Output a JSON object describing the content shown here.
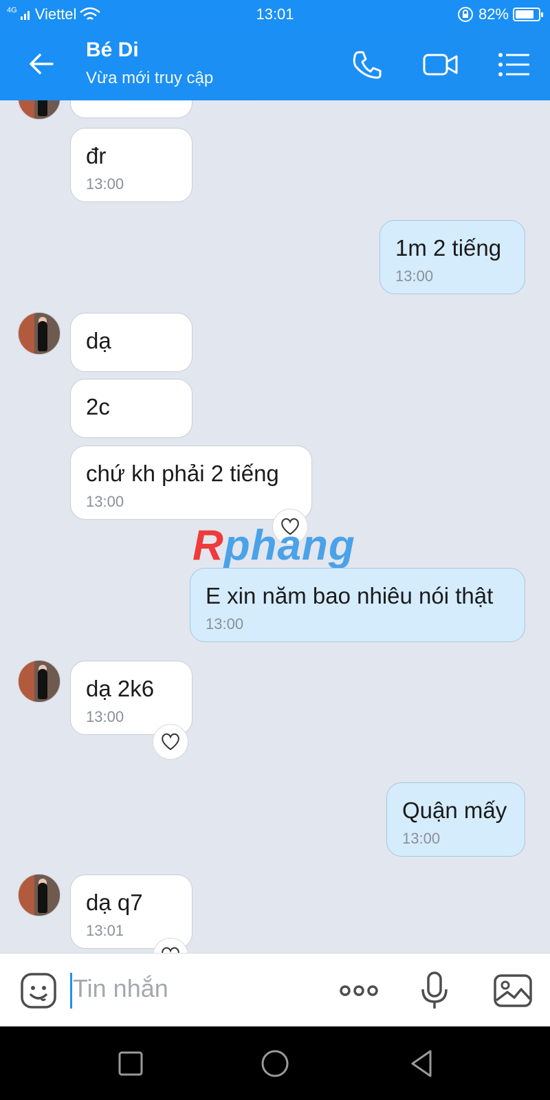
{
  "status": {
    "network": "4G",
    "carrier": "Viettel",
    "time": "13:01",
    "battery": "82%",
    "battery_level": 0.82
  },
  "header": {
    "title": "Bé Di",
    "subtitle": "Vừa mới truy cập",
    "back_icon": "arrow-left-icon",
    "call_icon": "phone-icon",
    "video_icon": "video-camera-icon",
    "menu_icon": "list-menu-icon"
  },
  "messages": [
    {
      "from": "contact",
      "text": "đr",
      "time": "13:00"
    },
    {
      "from": "me",
      "text": "1m 2 tiếng",
      "time": "13:00"
    },
    {
      "from": "contact",
      "text": "dạ"
    },
    {
      "from": "contact",
      "text": "2c"
    },
    {
      "from": "contact",
      "text": "chứ kh phải 2 tiếng",
      "time": "13:00"
    },
    {
      "from": "me",
      "text": "E xin năm bao nhiêu nói thật",
      "time": "13:00"
    },
    {
      "from": "contact",
      "text": "dạ 2k6",
      "time": "13:00"
    },
    {
      "from": "me",
      "text": "Quận mấy",
      "time": "13:00"
    },
    {
      "from": "contact",
      "text": "dạ q7",
      "time": "13:01"
    }
  ],
  "watermark": {
    "first": "R",
    "rest": "phang"
  },
  "input": {
    "placeholder": "Tin nhắn",
    "emoji_icon": "emoji-icon",
    "more_icon": "more-dots-icon",
    "mic_icon": "microphone-icon",
    "image_icon": "image-icon"
  },
  "colors": {
    "accent": "#1a8ff5",
    "my_bubble": "#d5ecfd",
    "chat_bg": "#e2e6ee"
  }
}
